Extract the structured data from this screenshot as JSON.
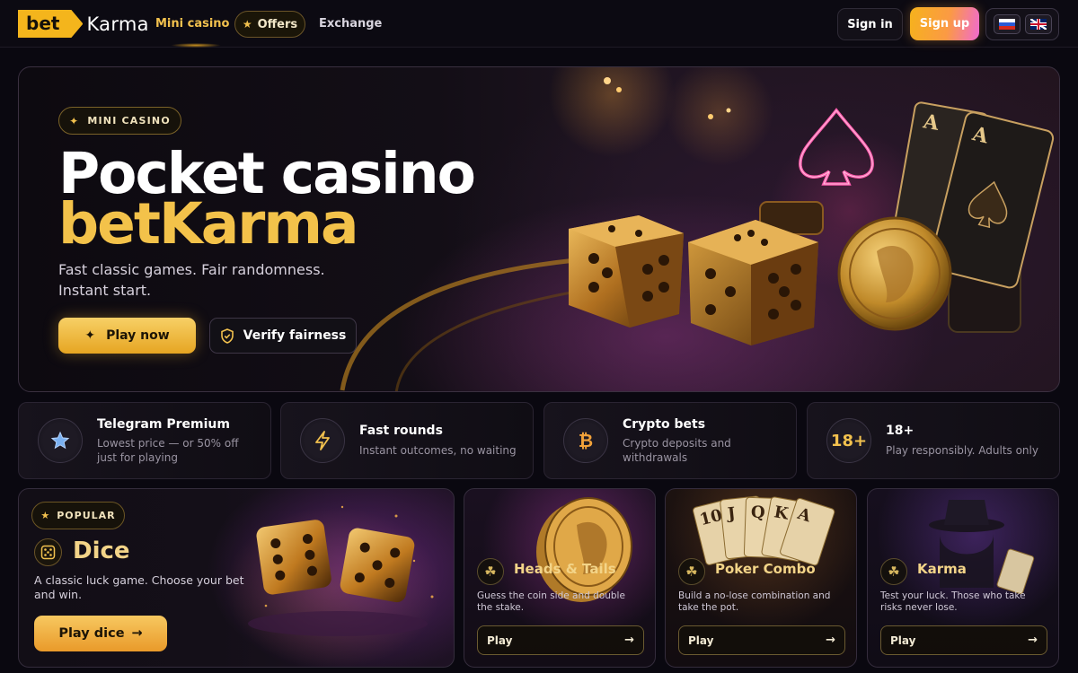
{
  "header": {
    "logo": {
      "bet": "bet",
      "karma": "Karma"
    },
    "nav": {
      "mini_casino": "Mini casino",
      "offers": "Offers",
      "exchange": "Exchange"
    },
    "sign_in": "Sign in",
    "sign_up": "Sign up",
    "languages": [
      "ru-flag",
      "uk-flag"
    ]
  },
  "hero": {
    "badge": "MINI CASINO",
    "title_line1": "Pocket casino",
    "title_line2": "betKarma",
    "subtitle": "Fast classic games. Fair randomness. Instant start.",
    "play_now": "Play now",
    "verify": "Verify fairness"
  },
  "features": [
    {
      "icon": "star-icon",
      "title": "Telegram Premium",
      "desc": "Lowest price — or 50% off just for playing"
    },
    {
      "icon": "lightning-icon",
      "title": "Fast rounds",
      "desc": "Instant outcomes, no waiting"
    },
    {
      "icon": "bitcoin-icon",
      "title": "Crypto bets",
      "desc": "Crypto deposits and withdrawals"
    },
    {
      "icon": "eighteen-plus-icon",
      "title": "18+",
      "desc": "Play responsibly. Adults only",
      "icon_text": "18+"
    }
  ],
  "dice_game": {
    "badge": "POPULAR",
    "title": "Dice",
    "desc": "A classic luck game. Choose your bet and win.",
    "button": "Play dice",
    "button_arrow": "→"
  },
  "games": [
    {
      "title": "Heads & Tails",
      "desc": "Guess the coin side and double the stake.",
      "button": "Play",
      "arrow": "→"
    },
    {
      "title": "Poker Combo",
      "desc": "Build a no-lose combination and take the pot.",
      "button": "Play",
      "arrow": "→"
    },
    {
      "title": "Karma",
      "desc": "Test your luck. Those who take risks never lose.",
      "button": "Play",
      "arrow": "→"
    }
  ],
  "colors": {
    "accent_gold": "#f3c24a",
    "background": "#0a0810",
    "signup_pink": "#f06ad0"
  }
}
